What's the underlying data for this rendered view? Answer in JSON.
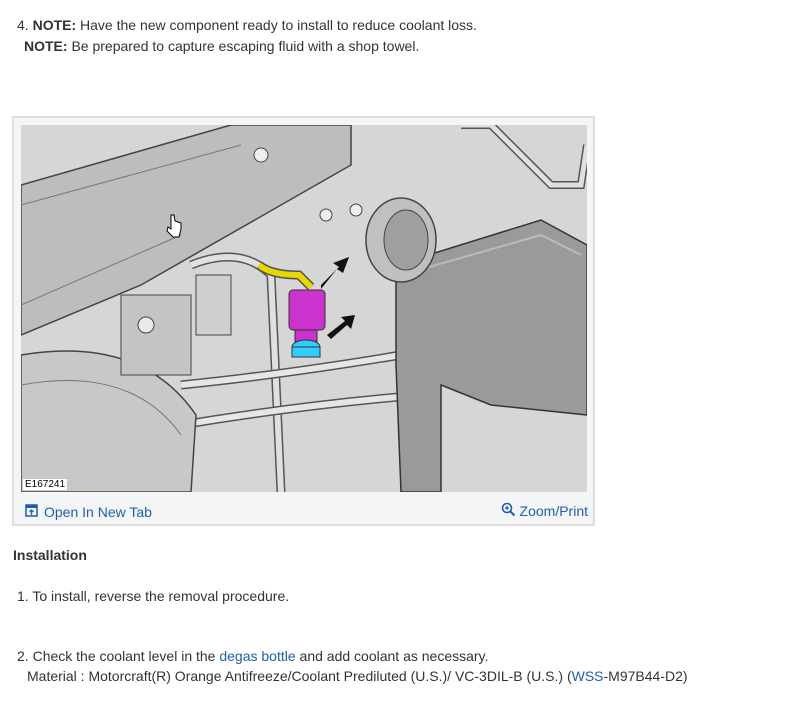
{
  "step4": {
    "number": "4.",
    "note_label": "NOTE:",
    "note_text": "Have the new component ready to install to reduce coolant loss.",
    "note2_label": "NOTE:",
    "note2_text": "Be prepared to capture escaping fluid with a shop towel."
  },
  "figure": {
    "image_id": "E167241",
    "open_label": "Open In New Tab",
    "zoom_label": "Zoom/Print",
    "icons": [
      "open-in-new-tab-icon",
      "zoom-icon"
    ]
  },
  "installation": {
    "heading": "Installation",
    "step1_number": "1.",
    "step1_text": "To install, reverse the removal procedure.",
    "step2_number": "2.",
    "step2_pre": "Check the coolant level in the",
    "step2_link": "degas bottle",
    "step2_post": "and add coolant as necessary.",
    "material_pre": "Material : Motorcraft(R) Orange Antifreeze/Coolant Prediluted (U.S.)/ VC-3DIL-B (U.S.) (",
    "material_link": "WSS",
    "material_post": "-M97B44-D2)"
  },
  "colors": {
    "link": "#1f5fa8",
    "text": "#333333",
    "hose_yellow": "#e8d800",
    "sensor_magenta": "#cc33cc",
    "sensor_cyan": "#33ccff"
  }
}
